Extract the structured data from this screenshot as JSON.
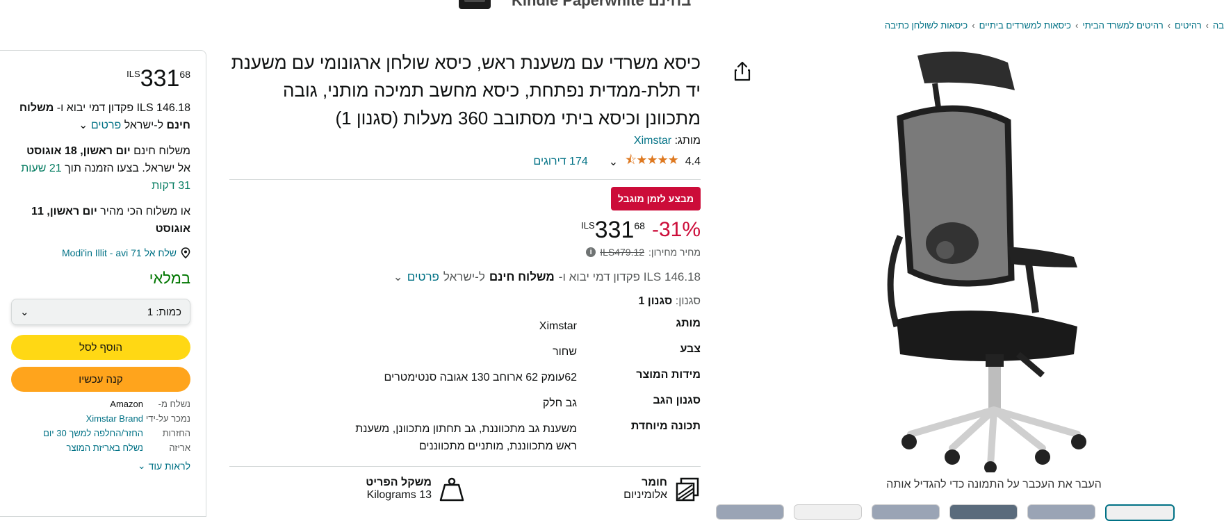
{
  "banner": {
    "text": "Kindle Paperwhite בחינם"
  },
  "breadcrumb": [
    "בה",
    "רהיטים",
    "רהיטים למשרד הביתי",
    "כיסאות למשרדים ביתיים",
    "כיסאות לשולחן כתיבה"
  ],
  "product": {
    "title": "כיסא משרדי עם משענת ראש, כיסא שולחן ארגונומי עם משענת יד תלת-ממדית נפתחת, כיסא מחשב תמיכה מותני, גובה מתכוונן וכיסא ביתי מסתובב 360 מעלות (סגנון 1)",
    "brand_label": "מותג:",
    "brand": "Ximstar",
    "rating": "4.4",
    "ratings_count": "174 דירוגים",
    "deal_badge": "מבצע לזמן מוגבל",
    "discount": "-31%",
    "price_currency": "ILS",
    "price_whole": "331",
    "price_fraction": "68",
    "list_price_label": "מחיר מחירון:",
    "list_price": "ILS479.12",
    "import_text": "ILS 146.18 פקדון דמי יבוא ו-",
    "free_shipping": "משלוח חינם",
    "to_israel": "ל-ישראל",
    "details_link": "פרטים",
    "style_label": "סגנון:",
    "style_value": "סגנון 1",
    "hover_hint": "העבר את העכבר על התמונה כדי להגדיל אותה"
  },
  "specs": [
    {
      "key": "מותג",
      "value": "Ximstar"
    },
    {
      "key": "צבע",
      "value": "שחור"
    },
    {
      "key": "מידות המוצר",
      "value": "62עומק 62 ארוחב 130 אגובה סנטימטרים"
    },
    {
      "key": "סגנון הגב",
      "value": "גב חלק"
    },
    {
      "key": "תכונה מיוחדת",
      "value": "משענת גב מתכווננת, גב תחתון מתכוונן, משענת ראש מתכווננת, מותניים מתכווננים"
    }
  ],
  "features": [
    {
      "title": "חומר",
      "value": "אלומיניום"
    },
    {
      "title": "משקל הפריט",
      "value": "13 Kilograms"
    }
  ],
  "buybox": {
    "price_currency": "ILS",
    "price_whole": "331",
    "price_fraction": "68",
    "import_text": "ILS 146.18 פקדון דמי יבוא ו-",
    "free_shipping": "משלוח חינם",
    "to_israel": "ל-ישראל",
    "details_link": "פרטים",
    "delivery_prefix": "משלוח חינם",
    "delivery_date": "יום ראשון, 18 אוגוסט",
    "delivery_suffix": "אל ישראל. בצעו הזמנה תוך",
    "countdown": "21 שעות 31 דקות",
    "fastest_prefix": "או משלוח הכי מהיר",
    "fastest_date": "יום ראשון, 11 אוגוסט",
    "location": "שלח אל 71 Modi'in Illit - avi",
    "stock": "במלאי",
    "qty_label": "כמות:",
    "qty_value": "1",
    "add_to_cart": "הוסף לסל",
    "buy_now": "קנה עכשיו",
    "seller": [
      {
        "label": "נשלח מ-",
        "value": "Amazon",
        "link": false
      },
      {
        "label": "נמכר על-ידי",
        "value": "Ximstar Brand",
        "link": true
      },
      {
        "label": "החזרות",
        "value": "החזר/החלפה למשך 30 יום",
        "link": true
      },
      {
        "label": "אריזה",
        "value": "נשלח באריזת המוצר",
        "link": true
      }
    ],
    "see_more": "לראות עוד"
  }
}
